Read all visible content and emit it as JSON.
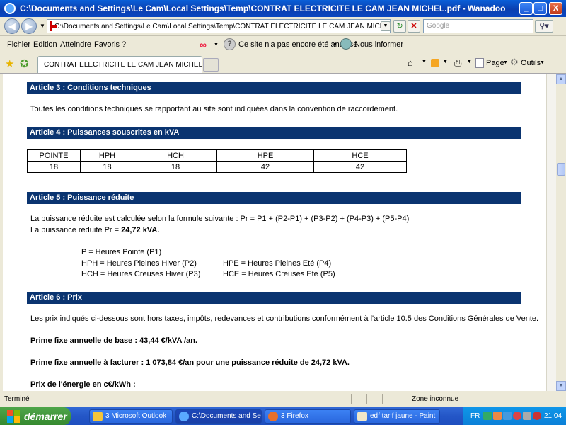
{
  "window": {
    "title": "C:\\Documents and Settings\\Le Cam\\Local Settings\\Temp\\CONTRAT ELECTRICITE LE CAM JEAN MICHEL.pdf - Wanadoo",
    "minimize": "_",
    "maximize": "□",
    "close": "X"
  },
  "address": {
    "url": "C:\\Documents and Settings\\Le Cam\\Local Settings\\Temp\\CONTRAT ELECTRICITE LE CAM JEAN MICHEL.pdf",
    "search_placeholder": "Google"
  },
  "menu": {
    "items": [
      "Fichier",
      "Edition",
      "Atteindre",
      "Favoris",
      "?"
    ],
    "site_status": "Ce site n'a pas encore été analysé",
    "inform": "Nous informer"
  },
  "tabs": {
    "active_label": "CONTRAT ELECTRICITE LE CAM JEAN MICHEL",
    "page_label": "Page",
    "tools_label": "Outils"
  },
  "document": {
    "article3": {
      "heading": "Article 3 : Conditions techniques",
      "text": "Toutes les conditions techniques se rapportant au site sont indiquées dans la convention de raccordement."
    },
    "article4": {
      "heading": "Article 4 : Puissances souscrites en kVA",
      "table": {
        "headers": [
          "POINTE",
          "HPH",
          "HCH",
          "HPE",
          "HCE"
        ],
        "values": [
          "18",
          "18",
          "18",
          "42",
          "42"
        ]
      }
    },
    "article5": {
      "heading": "Article 5 : Puissance réduite",
      "formula": "La puissance réduite est calculée selon la formule suivante : Pr = P1 +  (P2-P1) +  (P3-P2) +  (P4-P3) +  (P5-P4)",
      "result_prefix": "La puissance réduite Pr = ",
      "result_value": "24,72 kVA.",
      "legend": {
        "p1": "P = Heures Pointe (P1)",
        "p2": "HPH = Heures Pleines Hiver (P2)",
        "p3": "HCH = Heures Creuses Hiver (P3)",
        "p4": "HPE = Heures Pleines Eté (P4)",
        "p5": "HCE = Heures Creuses Eté (P5)"
      }
    },
    "article6": {
      "heading": "Article 6 : Prix",
      "intro": "Les prix indiqués ci-dessous sont hors taxes, impôts, redevances et contributions conformément à l'article 10.5 des Conditions Générales de Vente.",
      "prime_base_label": "Prime fixe annuelle de base : ",
      "prime_base_value": "43,44 €/kVA /an.",
      "prime_fact_label": "Prime fixe annuelle à facturer : ",
      "prime_fact_value": "1 073,84 €/an pour une puissance réduite de 24,72 kVA.",
      "energy_label": "Prix de l'énergie en c€/kWh :"
    }
  },
  "status": {
    "left": "Terminé",
    "zone": "Zone inconnue"
  },
  "taskbar": {
    "start": "démarrer",
    "tasks": [
      "3 Microsoft Outlook",
      "C:\\Documents and Se...",
      "3 Firefox",
      "edf tarif jaune - Paint"
    ],
    "lang": "FR",
    "clock": "21:04"
  }
}
